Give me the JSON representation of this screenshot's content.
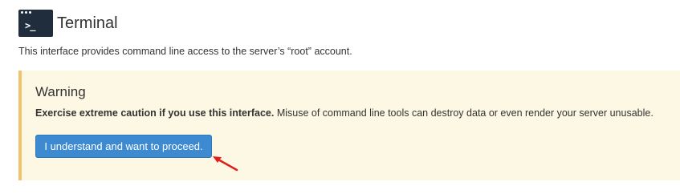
{
  "header": {
    "title": "Terminal",
    "icon": "terminal-icon",
    "icon_prompt": ">_"
  },
  "description": "This interface provides command line access to the server’s “root” account.",
  "warning": {
    "title": "Warning",
    "bold_text": "Exercise extreme caution if you use this interface.",
    "text": " Misuse of command line tools can destroy data or even render your server unusable.",
    "button_label": "I understand and want to proceed."
  },
  "colors": {
    "accent_button": "#3d8ad1",
    "warning_background": "#fcf8e3",
    "warning_border": "#f0c36d",
    "annotation_arrow": "#e0201b"
  }
}
